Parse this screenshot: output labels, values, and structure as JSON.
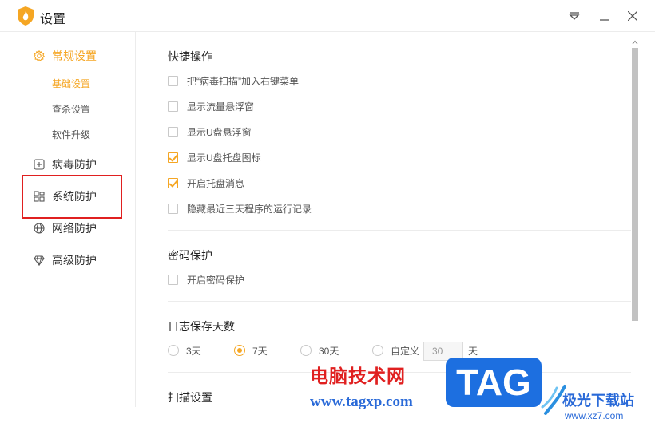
{
  "window": {
    "title": "设置",
    "controls": [
      "menu-dropdown-icon",
      "minimize-icon",
      "close-icon"
    ]
  },
  "colors": {
    "accent": "#f5a623",
    "highlight": "#e02020"
  },
  "sidebar": {
    "items": [
      {
        "label": "常规设置",
        "icon": "gear-icon",
        "active": true
      },
      {
        "label": "病毒防护",
        "icon": "plus-square-icon"
      },
      {
        "label": "系统防护",
        "icon": "grid-icon"
      },
      {
        "label": "网络防护",
        "icon": "globe-icon"
      },
      {
        "label": "高级防护",
        "icon": "diamond-icon"
      }
    ],
    "subitems": [
      {
        "label": "基础设置",
        "active": true
      },
      {
        "label": "查杀设置"
      },
      {
        "label": "软件升级"
      }
    ]
  },
  "quick_ops": {
    "title": "快捷操作",
    "options": [
      {
        "label": "把“病毒扫描”加入右键菜单",
        "checked": false
      },
      {
        "label": "显示流量悬浮窗",
        "checked": false
      },
      {
        "label": "显示U盘悬浮窗",
        "checked": false
      },
      {
        "label": "显示U盘托盘图标",
        "checked": true
      },
      {
        "label": "开启托盘消息",
        "checked": true
      },
      {
        "label": "隐藏最近三天程序的运行记录",
        "checked": false
      }
    ]
  },
  "password": {
    "title": "密码保护",
    "option": {
      "label": "开启密码保护",
      "checked": false
    }
  },
  "log_days": {
    "title": "日志保存天数",
    "options": [
      {
        "label": "3天",
        "selected": false
      },
      {
        "label": "7天",
        "selected": true
      },
      {
        "label": "30天",
        "selected": false
      },
      {
        "label": "自定义",
        "selected": false
      }
    ],
    "custom_value": "30",
    "unit": "天"
  },
  "scan": {
    "title": "扫描设置"
  },
  "watermark": {
    "cn": "电脑技术网",
    "url": "www.tagxp.com",
    "tag": "TAG",
    "site_cn": "极光下载站",
    "site_url": "www.xz7.com"
  }
}
